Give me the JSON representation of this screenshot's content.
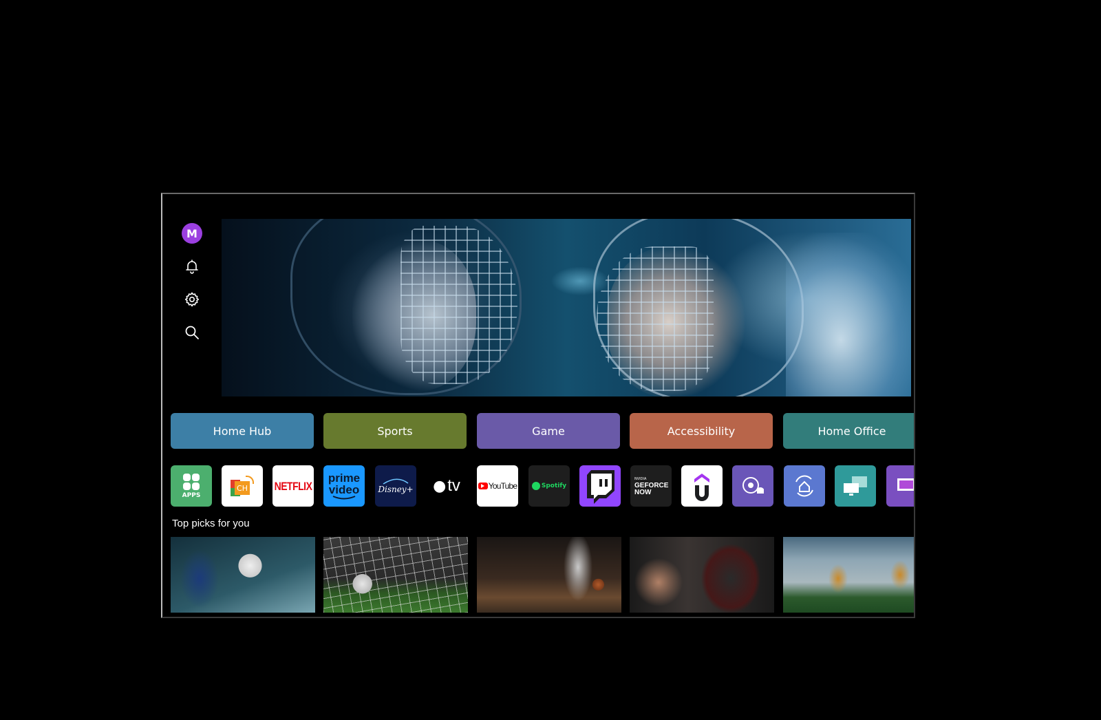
{
  "sidebar": {
    "avatar_initial": "M",
    "items": [
      {
        "name": "profile",
        "icon": "avatar"
      },
      {
        "name": "notifications",
        "icon": "bell-icon"
      },
      {
        "name": "settings",
        "icon": "gear-icon"
      },
      {
        "name": "search",
        "icon": "search-icon"
      }
    ]
  },
  "hero": {
    "description": "Two hockey players in caged helmets facing each other"
  },
  "categories": [
    {
      "label": "Home Hub",
      "color": "#3d7fa6"
    },
    {
      "label": "Sports",
      "color": "#677a2e"
    },
    {
      "label": "Game",
      "color": "#6a5aa8"
    },
    {
      "label": "Accessibility",
      "color": "#b8654a"
    },
    {
      "label": "Home Office",
      "color": "#327d7b"
    }
  ],
  "apps": [
    {
      "name": "apps",
      "label": "APPS",
      "bg": "#4caf6e"
    },
    {
      "name": "live-tv",
      "label": "CH",
      "bg": "#ffffff"
    },
    {
      "name": "netflix",
      "label": "NETFLIX",
      "bg": "#ffffff"
    },
    {
      "name": "prime-video",
      "label_top": "prime",
      "label_bottom": "video",
      "bg": "#1a98ff"
    },
    {
      "name": "disney-plus",
      "label": "Disney+",
      "bg": "#0e1b4a"
    },
    {
      "name": "apple-tv",
      "label": "tv",
      "bg": "#000000"
    },
    {
      "name": "youtube",
      "label": "YouTube",
      "bg": "#ffffff"
    },
    {
      "name": "spotify",
      "label": "Spotify",
      "bg": "#1e1e1e"
    },
    {
      "name": "twitch",
      "label": "",
      "bg": "#9146ff"
    },
    {
      "name": "geforce-now",
      "label_top": "NVIDIA",
      "label_mid": "GEFORCE",
      "label_bottom": "NOW",
      "bg": "#1e1e1e"
    },
    {
      "name": "udemy",
      "label": "U",
      "bg": "#ffffff"
    },
    {
      "name": "sports-alert",
      "label": "",
      "bg": "#6a56b8"
    },
    {
      "name": "home-hub-app",
      "label": "",
      "bg": "#5b78d0"
    },
    {
      "name": "screen-share",
      "label": "",
      "bg": "#2f9a9a"
    },
    {
      "name": "music-app",
      "label": "",
      "bg": "#7a4fc0"
    }
  ],
  "top_picks": {
    "title": "Top picks for you",
    "items": [
      {
        "name": "soccer-kick",
        "description": "Soccer player kicking ball"
      },
      {
        "name": "soccer-goal-net",
        "description": "Soccer ball in goal net"
      },
      {
        "name": "basketball",
        "description": "Basketball player dribbling"
      },
      {
        "name": "boxing",
        "description": "Boxer throwing punch"
      },
      {
        "name": "american-football",
        "description": "Football players running on field"
      }
    ]
  }
}
